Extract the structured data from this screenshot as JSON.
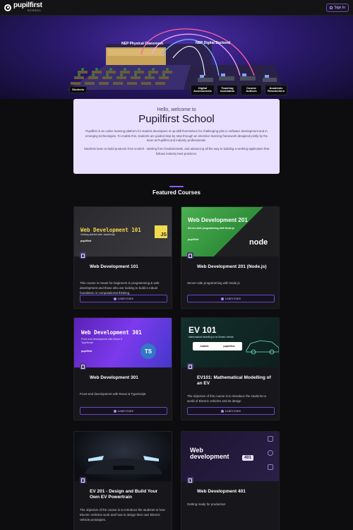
{
  "header": {
    "brand_name": "pupilfirst",
    "brand_sub": "SCHOOL",
    "signin_label": "Sign In"
  },
  "hero": {
    "physical_label": "NEP Physical Classroom",
    "digital_label": "NEP Digital Backend",
    "tags": [
      "Students",
      "Digital Assessments",
      "Teaching Assistants",
      "Course Authors",
      "Academic Researchers"
    ]
  },
  "welcome": {
    "hello": "Hello, welcome to",
    "school": "Pupilfirst School",
    "para1": "Pupilfirst is an online learning platform for student developers to up-skill themselves for challenging jobs in software development and in emerging technologies. To enable this, students are guided step-by-step through an intensive learning framework designed jointly by the team at Pupilfirst and industry professionals.",
    "para2": "Students learn to build products from scratch - starting from fundamentals, and advancing all the way to building a working application that follows industry best practices."
  },
  "section_title": "Featured Courses",
  "learn_more_label": "Learn more",
  "courses": [
    {
      "title": "Web Development 101",
      "desc": "This course is meant for beginners in programming & web development and those who are looking to build a robust foundation in computational thinking.",
      "thumb_title": "Web Development 101",
      "thumb_sub": "Getting started with JavaScript",
      "thumb_badge": "JS"
    },
    {
      "title": "Web Development 201 (Node.js)",
      "desc": "Server-side programming with Node.js",
      "thumb_title": "Web Development 201",
      "thumb_sub": "Server-side programming with Node.js",
      "thumb_badge": "node"
    },
    {
      "title": "Web Development 301",
      "desc": "Front-end development with React & TypeScript",
      "thumb_title": "Web Development 301",
      "thumb_sub": "Front-end development with React & TypeScript",
      "thumb_badge": "TS"
    },
    {
      "title": "EV101: Mathematical Modelling of an EV",
      "desc": "The objective of this course is to introduce the students to world of Electric vehicles and its design",
      "thumb_title": "EV 101",
      "thumb_sub": "Mathematical Modelling of an Electric Vehicle",
      "thumb_badge": "mobile"
    },
    {
      "title": "EV 201 - Design and Build Your Own EV Powertrain",
      "desc": "The objective of the course is to introduce the students to how Electric Vehicles work and how to design their own Electric Vehicle prototypes.",
      "thumb_title": "",
      "thumb_sub": "",
      "thumb_badge": ""
    },
    {
      "title": "Web Development 401",
      "desc": "Getting ready for production",
      "thumb_title": "Web development",
      "thumb_sub": "",
      "thumb_badge": "401"
    }
  ],
  "pupilfirst_badge": "pupilfirst",
  "colors": {
    "accent": "#6b46c1",
    "card_bg": "#17171b",
    "welcome_bg": "#e9e0ff"
  }
}
